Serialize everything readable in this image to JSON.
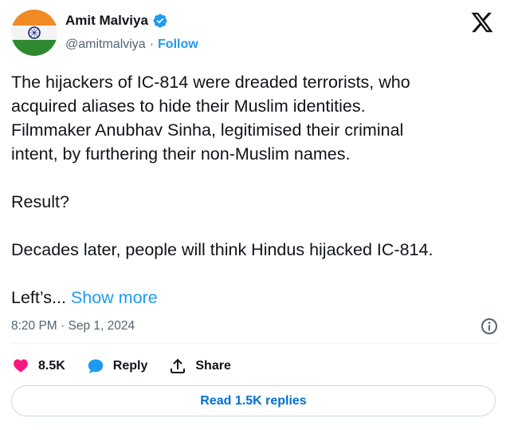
{
  "author": {
    "display_name": "Amit Malviya",
    "handle": "@amitmalviya",
    "separator": "·",
    "follow_label": "Follow"
  },
  "tweet": {
    "lines": [
      "The hijackers of IC-814 were dreaded terrorists, who",
      "acquired aliases to hide their Muslim identities.",
      "Filmmaker Anubhav Sinha, legitimised their criminal",
      "intent, by furthering their non-Muslim names.",
      "Result?",
      "Decades later, people will think Hindus hijacked IC-814.",
      "Left’s..."
    ],
    "show_more_label": "Show more"
  },
  "meta": {
    "timestamp": "8:20 PM · Sep 1, 2024"
  },
  "actions": {
    "like_count": "8.5K",
    "reply_label": "Reply",
    "share_label": "Share"
  },
  "replies_button_label": "Read 1.5K replies",
  "colors": {
    "accent": "#1d9bf0",
    "like": "#f91880",
    "text": "#0f1419",
    "muted": "#536471",
    "link_button": "#006fd6"
  },
  "icons": [
    "india-flag-avatar",
    "verified-badge-icon",
    "x-logo-icon",
    "info-icon",
    "heart-icon",
    "reply-bubble-icon",
    "share-icon"
  ]
}
